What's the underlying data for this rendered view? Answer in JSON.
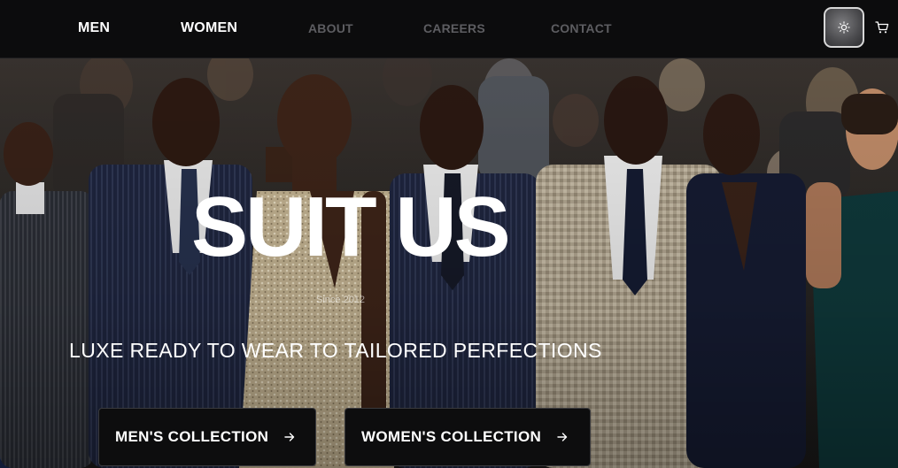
{
  "nav": {
    "links": [
      {
        "label": "MEN",
        "style": "primary"
      },
      {
        "label": "WOMEN",
        "style": "primary"
      },
      {
        "label": "ABOUT",
        "style": "muted"
      },
      {
        "label": "CAREERS",
        "style": "muted"
      },
      {
        "label": "CONTACT",
        "style": "muted"
      }
    ],
    "theme_toggle_icon": "sun-icon",
    "cart_icon": "cart-icon"
  },
  "hero": {
    "title": "SUIT US",
    "since": "Since 2012",
    "tagline": "LUXE READY TO WEAR TO TAILORED PERFECTIONS",
    "background_image": "runway models in suits and gowns in front of seated audience",
    "ctas": [
      {
        "label": "MEN'S COLLECTION",
        "icon": "arrow-right-icon"
      },
      {
        "label": "WOMEN'S COLLECTION",
        "icon": "arrow-right-icon"
      }
    ]
  },
  "colors": {
    "nav_bg": "#0c0c0d",
    "nav_primary": "#ffffff",
    "nav_muted": "#5d5d61",
    "cta_bg": "#0d0d0e"
  }
}
